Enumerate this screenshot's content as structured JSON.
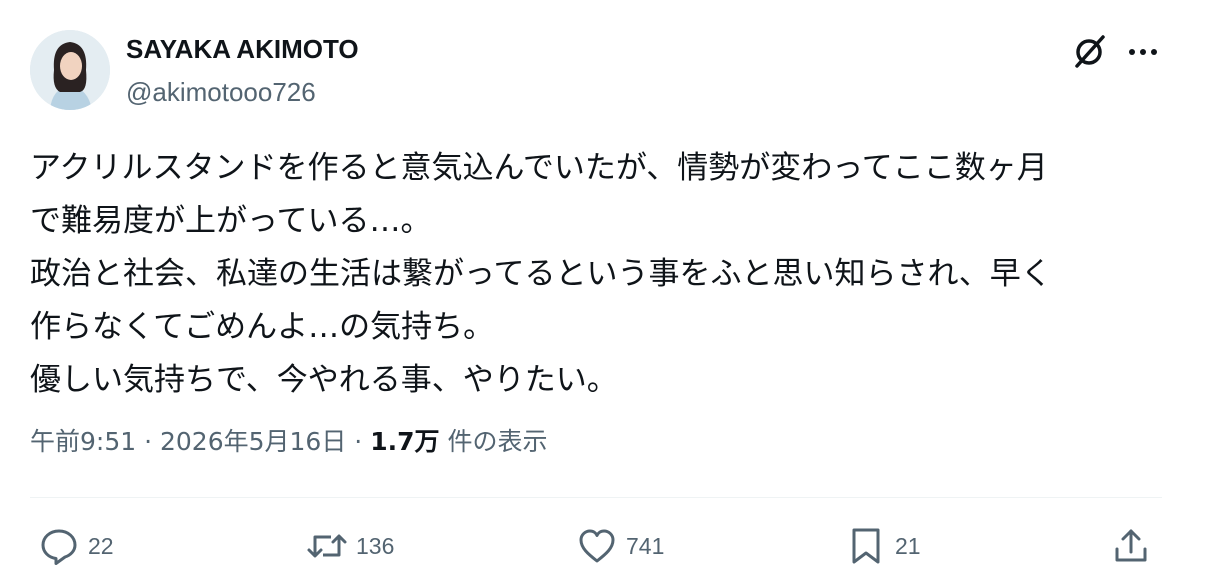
{
  "user": {
    "display_name": "SAYAKA AKIMOTO",
    "handle": "@akimotooo726"
  },
  "tweet": {
    "text_lines": [
      "アクリルスタンドを作ると意気込んでいたが、情勢が変わってここ数ヶ月",
      "で難易度が上がっている…。",
      "政治と社会、私達の生活は繋がってるという事をふと思い知らされ、早く",
      "作らなくてごめんよ…の気持ち。",
      "優しい気持ちで、今やれる事、やりたい。"
    ],
    "time": "午前9:51",
    "date": "2026年5月16日",
    "separator": "·",
    "views_count": "1.7万",
    "views_label": "件の表示"
  },
  "actions": {
    "replies": "22",
    "reposts": "136",
    "likes": "741",
    "bookmarks": "21"
  },
  "icons": {
    "header": [
      "grok-icon",
      "more-icon"
    ],
    "actions": [
      "reply-icon",
      "repost-icon",
      "like-icon",
      "bookmark-icon",
      "share-icon"
    ]
  },
  "colors": {
    "text": "#0f1419",
    "secondary": "#536471",
    "divider": "#eff3f4"
  }
}
